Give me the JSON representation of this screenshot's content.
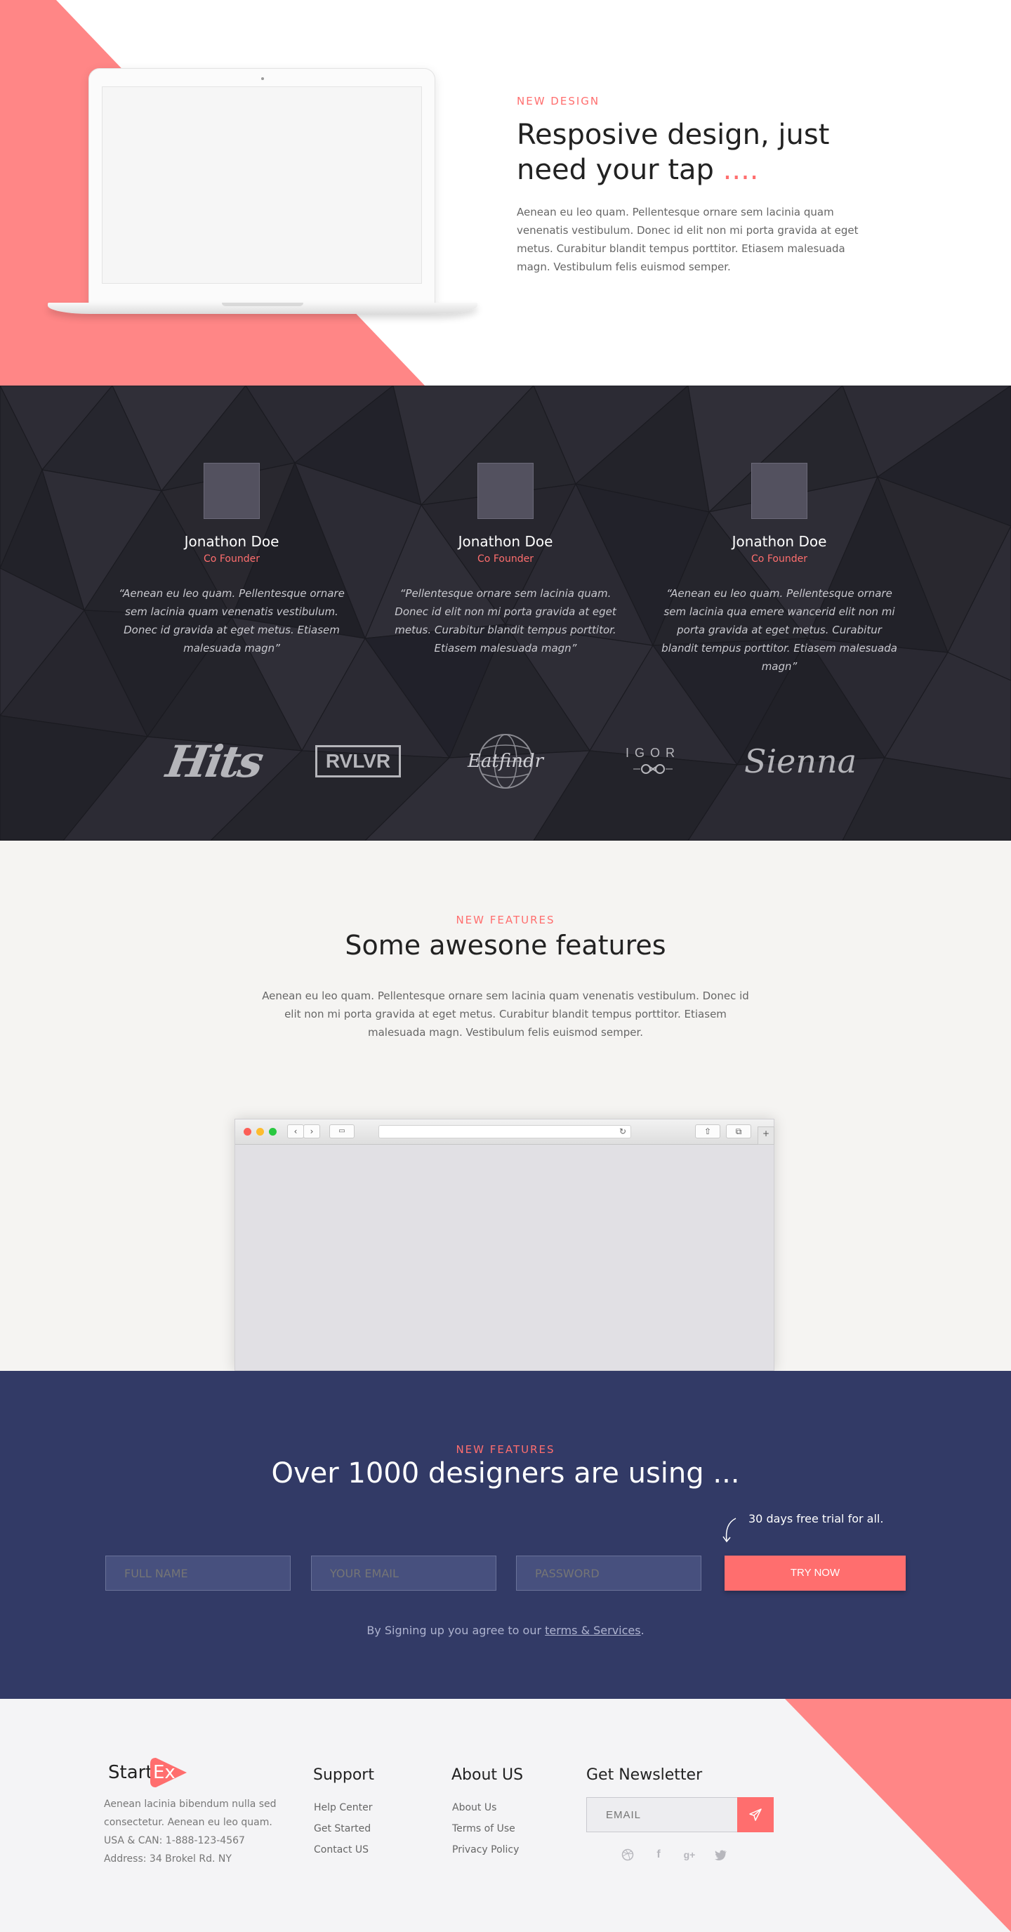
{
  "hero": {
    "eyebrow": "NEW DESIGN",
    "title_line1": "Resposive design, just",
    "title_line2": "need your tap ",
    "title_dots": "....",
    "paragraph": "Aenean eu leo quam. Pellentesque ornare sem lacinia quam venenatis vestibulum. Donec id elit non mi porta gravida at eget metus. Curabitur blandit tempus porttitor. Etiasem malesuada magn. Vestibulum felis euismod semper."
  },
  "team": {
    "members": [
      {
        "name": "Jonathon Doe",
        "role": "Co Founder",
        "quote": "“Aenean eu leo quam. Pellentesque ornare sem lacinia quam venenatis vestibulum. Donec id gravida at eget metus. Etiasem malesuada magn”"
      },
      {
        "name": "Jonathon Doe",
        "role": "Co Founder",
        "quote": "“Pellentesque ornare sem lacinia quam. Donec id elit non mi porta gravida at eget metus. Curabitur blandit tempus porttitor. Etiasem malesuada magn”"
      },
      {
        "name": "Jonathon Doe",
        "role": "Co Founder",
        "quote": "“Aenean eu leo quam. Pellentesque ornare sem lacinia qua emere wancerid elit non mi porta gravida at eget metus. Curabitur blandit tempus porttitor. Etiasem malesuada magn”"
      }
    ],
    "logos": [
      "Hits",
      "RVLVR",
      "Eatfindr",
      "IGOR",
      "Sienna"
    ]
  },
  "features": {
    "eyebrow": "NEW FEATURES",
    "title": "Some awesone features",
    "paragraph": "Aenean eu leo quam. Pellentesque ornare sem lacinia quam venenatis vestibulum. Donec id elit non mi porta gravida at eget metus. Curabitur blandit tempus porttitor. Etiasem malesuada magn. Vestibulum felis euismod semper."
  },
  "signup": {
    "eyebrow": "NEW FEATURES",
    "title": "Over 1000 designers are using ...",
    "trial_note": "30 days free trial for all.",
    "fields": {
      "full_name": "FULL NAME",
      "email": "YOUR EMAIL",
      "password": "PASSWORD"
    },
    "button": "TRY NOW",
    "terms_prefix": "By Signing up you agree to our ",
    "terms_link": "terms & Services",
    "terms_suffix": "."
  },
  "footer": {
    "brand_start": "Start",
    "brand_ex": "Ex",
    "about_line1": "Aenean lacinia bibendum nulla sed",
    "about_line2": "consectetur. Aenean eu leo quam.",
    "about_line3": "USA &  CAN: 1-888-123-4567",
    "about_line4": "Address: 34 Brokel Rd. NY",
    "support": {
      "title": "Support",
      "links": [
        "Help Center",
        "Get Started",
        "Contact US"
      ]
    },
    "about": {
      "title": "About US",
      "links": [
        "About Us",
        "Terms of Use",
        "Privacy Policy"
      ]
    },
    "newsletter": {
      "title": "Get Newsletter",
      "placeholder": "EMAIL"
    },
    "social_icons": [
      "dribbble-icon",
      "facebook-icon",
      "google-plus-icon",
      "twitter-icon"
    ]
  },
  "colors": {
    "accent": "#ff6e6e",
    "dark": "#25252c",
    "navy": "#323a66",
    "light": "#f5f4f2"
  }
}
